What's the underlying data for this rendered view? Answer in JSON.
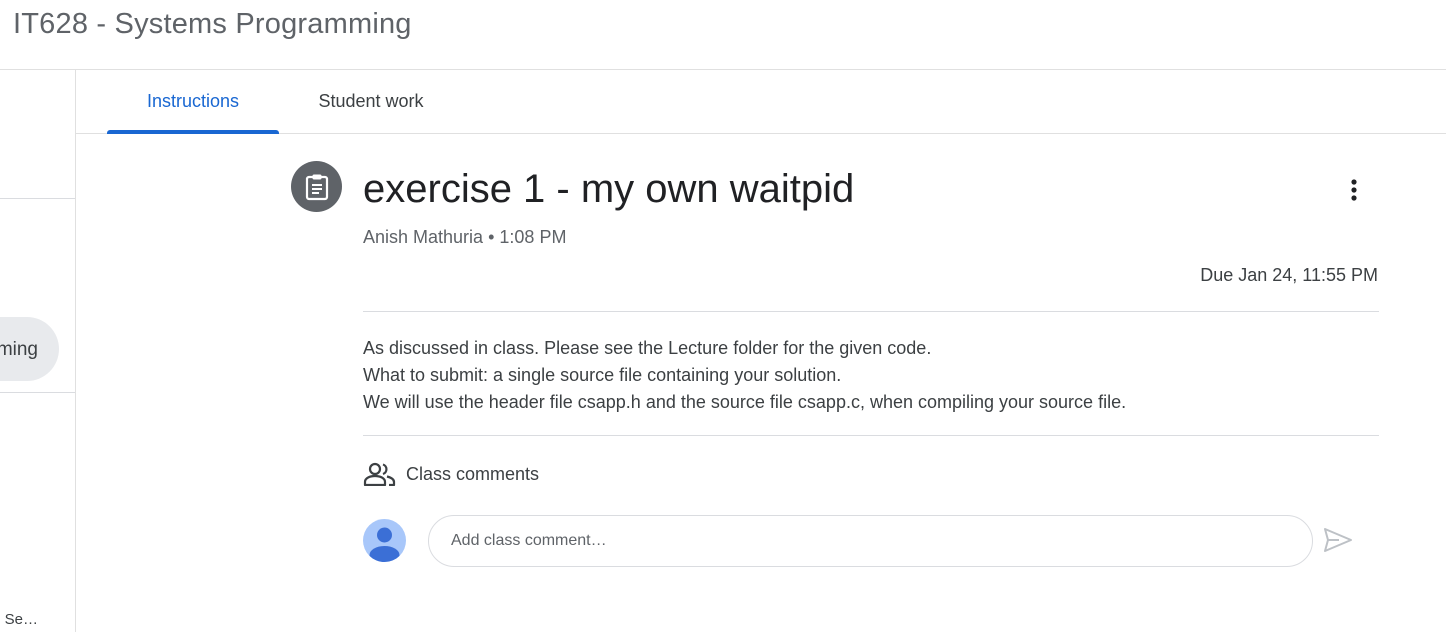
{
  "app": {
    "title": "IT628 - Systems Programming"
  },
  "sidebar": {
    "active_item_partial": "ming",
    "bottom_item_partial": "l Se…"
  },
  "tabs": [
    {
      "label": "Instructions",
      "active": true
    },
    {
      "label": "Student work",
      "active": false
    }
  ],
  "assignment": {
    "icon": "assignment-icon",
    "title": "exercise 1 - my own waitpid",
    "author": "Anish Mathuria",
    "separator": "•",
    "time": "1:08 PM",
    "due": "Due Jan 24, 11:55 PM",
    "body": [
      "As discussed in class. Please see the Lecture folder for the given code.",
      "What to submit: a single source file containing your solution.",
      "We will use the header file csapp.h and the source file csapp.c, when compiling your source file."
    ]
  },
  "comments": {
    "icon": "people-icon",
    "heading": "Class comments",
    "placeholder": "Add class comment…",
    "send_icon": "send-icon"
  },
  "colors": {
    "accent": "#1967d2",
    "icon_bg": "#5f6368",
    "avatar_bg": "#a8c7fa",
    "avatar_fg": "#3b6fd6"
  }
}
